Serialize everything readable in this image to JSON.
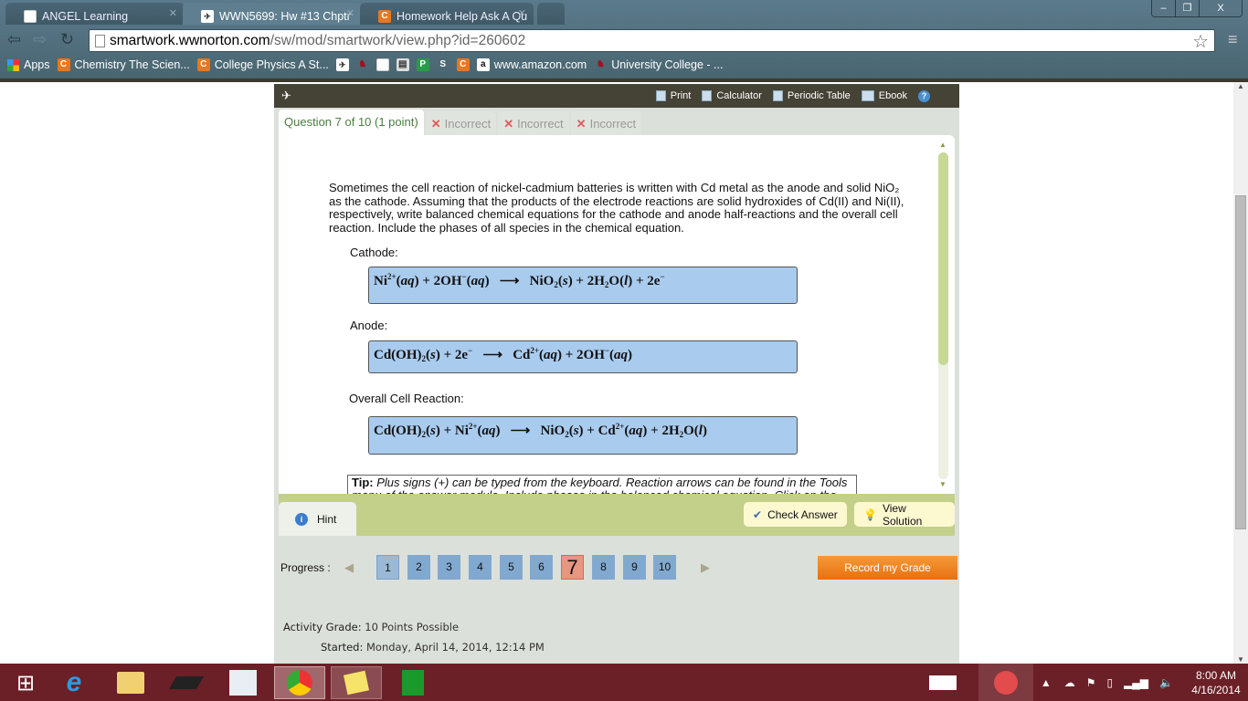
{
  "browser": {
    "tabs": [
      {
        "title": "ANGEL Learning",
        "favicon": "page-icon",
        "active": false
      },
      {
        "title": "WWN5699: Hw #13 Chptr",
        "favicon": "norton-bird-icon",
        "active": true
      },
      {
        "title": "Homework Help Ask A Qu",
        "favicon": "chegg-c-icon",
        "active": false
      }
    ],
    "window_controls": {
      "minimize": "–",
      "restore": "❐",
      "close": "X"
    },
    "url_host": "smartwork.wwnorton.com",
    "url_path": "/sw/mod/smartwork/view.php?id=260602",
    "bookmarks": [
      {
        "label": "Apps",
        "icon": "apps-grid-icon"
      },
      {
        "label": "Chemistry The Scien...",
        "icon": "chegg-c-icon"
      },
      {
        "label": "College Physics A St...",
        "icon": "chegg-c-icon"
      },
      {
        "label": "",
        "icon": "norton-bird-icon"
      },
      {
        "label": "",
        "icon": "wsu-cougar-icon"
      },
      {
        "label": "",
        "icon": "page-icon"
      },
      {
        "label": "",
        "icon": "clipboard-icon"
      },
      {
        "label": "",
        "icon": "p-green-icon"
      },
      {
        "label": "",
        "icon": "s-icon"
      },
      {
        "label": "",
        "icon": "chegg-c-icon"
      },
      {
        "label": "www.amazon.com",
        "icon": "amazon-icon"
      },
      {
        "label": "University College - ...",
        "icon": "wsu-cougar-icon"
      }
    ]
  },
  "app": {
    "toolbar": {
      "print": "Print",
      "calculator": "Calculator",
      "periodic_table": "Periodic Table",
      "ebook": "Ebook",
      "help_glyph": "?"
    },
    "question_tab": "Question 7 of 10 (1 point)",
    "attempt_tabs": [
      "Incorrect",
      "Incorrect",
      "Incorrect"
    ],
    "question_text": "Sometimes the cell reaction of nickel-cadmium batteries is written with Cd metal as the anode and solid NiO₂ as the cathode. Assuming that the products of the electrode reactions are solid hydroxides of Cd(II) and Ni(II), respectively, write balanced chemical equations for the cathode and anode half-reactions and the overall cell reaction. Include the phases of all species in the chemical equation.",
    "sections": {
      "cathode_label": "Cathode:",
      "anode_label": "Anode:",
      "overall_label": "Overall Cell Reaction:"
    },
    "answers": {
      "cathode": "Ni²⁺(aq) + 2OH⁻(aq) ⟶ NiO₂(s) + 2H₂O(l) + 2e⁻",
      "anode": "Cd(OH)₂(s) + 2e⁻ ⟶ Cd²⁺(aq) + 2OH⁻(aq)",
      "overall": "Cd(OH)₂(s) + Ni²⁺(aq) ⟶ NiO₂(s) + Cd²⁺(aq) + 2H₂O(l)"
    },
    "tip": {
      "label": "Tip:",
      "text": "Plus signs (+) can be typed from the keyboard. Reaction arrows can be found in the Tools menu of the answer module. Include phases in the balanced chemical equation. Click on the"
    },
    "actions": {
      "hint": "Hint",
      "check_answer": "Check Answer",
      "view_solution": "View Solution"
    },
    "progress": {
      "label": "Progress :",
      "pages": [
        "1",
        "2",
        "3",
        "4",
        "5",
        "6",
        "7",
        "8",
        "9",
        "10"
      ],
      "current": "7",
      "record_grade": "Record my Grade"
    },
    "activity": {
      "grade_label": "Activity Grade:",
      "grade_value": "10 Points Possible",
      "started_label": "Started:",
      "started_value": "Monday, April 14, 2014, 12:14 PM"
    }
  },
  "taskbar": {
    "apps": [
      "windows-start-icon",
      "internet-explorer-icon",
      "file-explorer-icon",
      "laptop-icon",
      "intel-appup-icon",
      "chrome-icon",
      "sticky-notes-icon",
      "windows-store-icon"
    ],
    "clock_time": "8:00 AM",
    "clock_date": "4/16/2014"
  }
}
